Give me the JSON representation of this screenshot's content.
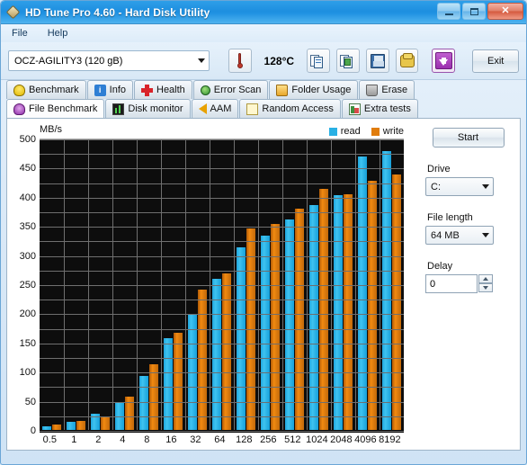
{
  "window": {
    "title": "HD Tune Pro 4.60 - Hard Disk Utility",
    "icon": "hdtune-diamond-icon",
    "buttons": {
      "minimize": "–",
      "maximize": "□",
      "close": "✕"
    }
  },
  "menu": {
    "items": [
      {
        "label": "File"
      },
      {
        "label": "Help"
      }
    ]
  },
  "toolbar": {
    "drive_value": "OCZ-AGILITY3 (120 gB)",
    "temperature": "128°C",
    "icons": [
      {
        "name": "copy-icon"
      },
      {
        "name": "copy-image-icon"
      },
      {
        "name": "save-icon"
      },
      {
        "name": "options-icon"
      },
      {
        "name": "download-icon"
      }
    ],
    "exit_label": "Exit"
  },
  "tabs": {
    "row1": [
      {
        "label": "Benchmark",
        "icon": "bulb-icon",
        "selected": false
      },
      {
        "label": "Info",
        "icon": "info-icon",
        "selected": false
      },
      {
        "label": "Health",
        "icon": "health-cross-icon",
        "selected": false
      },
      {
        "label": "Error Scan",
        "icon": "magnifier-icon",
        "selected": false
      },
      {
        "label": "Folder Usage",
        "icon": "folder-icon",
        "selected": false
      },
      {
        "label": "Erase",
        "icon": "trash-icon",
        "selected": false
      }
    ],
    "row2": [
      {
        "label": "File Benchmark",
        "icon": "file-benchmark-icon",
        "selected": true
      },
      {
        "label": "Disk monitor",
        "icon": "monitor-chart-icon",
        "selected": false
      },
      {
        "label": "AAM",
        "icon": "speaker-icon",
        "selected": false
      },
      {
        "label": "Random Access",
        "icon": "random-dots-icon",
        "selected": false
      },
      {
        "label": "Extra tests",
        "icon": "extra-chart-icon",
        "selected": false
      }
    ]
  },
  "controls": {
    "start_label": "Start",
    "drive_label": "Drive",
    "drive_value": "C:",
    "file_length_label": "File length",
    "file_length_value": "64 MB",
    "delay_label": "Delay",
    "delay_value": "0"
  },
  "colors": {
    "read": "#29b0e4",
    "write": "#e07c0c",
    "plot_bg": "#0d0d0d",
    "grid": "#6f6f6f",
    "title_bar": "#1e8fe0"
  },
  "chart_data": {
    "type": "bar",
    "title": "",
    "unit_label": "MB/s",
    "xlabel": "",
    "ylabel": "MB/s",
    "ylim": [
      0,
      500
    ],
    "ytick_step": 50,
    "gridline_step": 25,
    "grid": true,
    "legend_position": "top-right",
    "categories": [
      "0.5",
      "1",
      "2",
      "4",
      "8",
      "16",
      "32",
      "64",
      "128",
      "256",
      "512",
      "1024",
      "2048",
      "4096",
      "8192"
    ],
    "series": [
      {
        "name": "read",
        "color": "#29b0e4",
        "values": [
          6,
          14,
          28,
          48,
          92,
          158,
          197,
          259,
          313,
          333,
          361,
          386,
          403,
          469,
          478
        ]
      },
      {
        "name": "write",
        "color": "#e07c0c",
        "values": [
          10,
          16,
          23,
          57,
          112,
          167,
          241,
          268,
          345,
          353,
          380,
          414,
          405,
          427,
          438
        ]
      }
    ]
  }
}
